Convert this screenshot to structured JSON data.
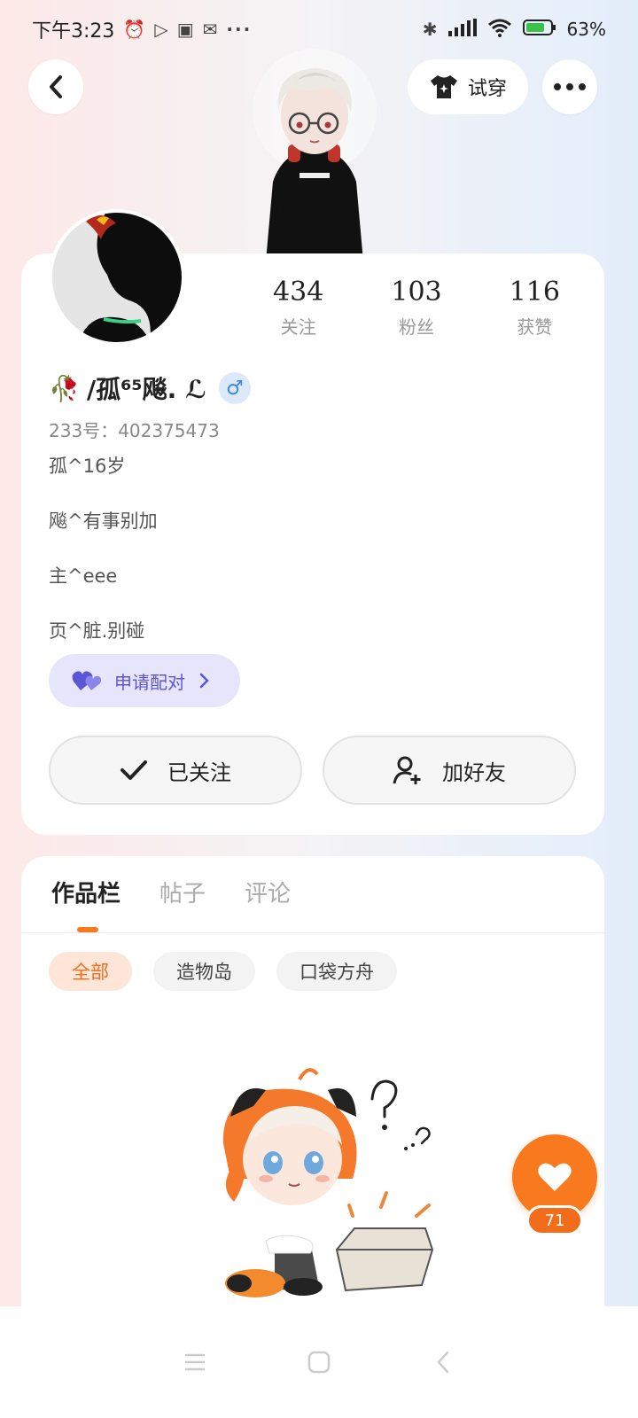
{
  "status_bar": {
    "time": "下午3:23",
    "battery": "63%"
  },
  "header": {
    "tryon_label": "试穿"
  },
  "profile": {
    "nickname": "/孤⁶⁵飚. ℒ",
    "uid_label": "233号：",
    "uid": "402375473",
    "stats": [
      {
        "value": "434",
        "label": "关注"
      },
      {
        "value": "103",
        "label": "粉丝"
      },
      {
        "value": "116",
        "label": "获赞"
      }
    ],
    "bio": [
      "孤^16岁",
      "飚^有事别加",
      "主^eee",
      "页^脏.别碰"
    ],
    "pair_label": "申请配对",
    "follow_label": "已关注",
    "add_friend_label": "加好友"
  },
  "works": {
    "tabs": [
      "作品栏",
      "帖子",
      "评论"
    ],
    "chips": [
      "全部",
      "造物岛",
      "口袋方舟"
    ]
  },
  "like": {
    "count": "71"
  },
  "colors": {
    "accent": "#f97a1e",
    "pair": "#5b56d6",
    "gender": "#3a86e8"
  }
}
